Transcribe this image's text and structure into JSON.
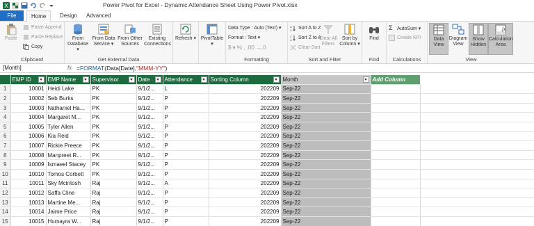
{
  "window": {
    "title": "Power Pivot for Excel - Dynamic Attendance Sheet Using Power Pivot.xlsx"
  },
  "tabs": {
    "file": "File",
    "home": "Home",
    "design": "Design",
    "advanced": "Advanced"
  },
  "ribbon": {
    "clipboard": {
      "label": "Clipboard",
      "paste": "Paste",
      "paste_append": "Paste Append",
      "paste_replace": "Paste Replace",
      "copy": "Copy"
    },
    "external": {
      "label": "Get External Data",
      "from_database": "From Database ▾",
      "from_data_service": "From Data Service ▾",
      "from_other_sources": "From Other Sources",
      "existing_connections": "Existing Connections"
    },
    "refresh": {
      "refresh": "Refresh ▾"
    },
    "pivot": {
      "pivottable": "PivotTable ▾"
    },
    "formatting": {
      "label": "Formatting",
      "data_type": "Data Type : Auto (Text) ▾",
      "format": "Format : Text ▾",
      "symbols": "$ ▾  %  ,  .00  →.0"
    },
    "sort_filter": {
      "label": "Sort and Filter",
      "sort_az": "Sort A to Z",
      "sort_za": "Sort Z to A",
      "clear_sort": "Clear Sort",
      "clear_all_filters": "Clear All Filters",
      "sort_by_column": "Sort by Column ▾"
    },
    "find": {
      "label": "Find",
      "find": "Find"
    },
    "calculations": {
      "label": "Calculations",
      "autosum": "AutoSum ▾",
      "create_kpi": "Create KPI"
    },
    "view": {
      "label": "View",
      "data_view": "Data View",
      "diagram_view": "Diagram View",
      "show_hidden": "Show Hidden",
      "calculation_area": "Calculation Area"
    }
  },
  "formula_bar": {
    "name_box": "[Month]",
    "fx": "fx",
    "formula_prefix": "=",
    "formula_fn": "FORMAT",
    "formula_args": "(Data[Date],",
    "formula_str": "\"MMM-YY\"",
    "formula_close": ")"
  },
  "table": {
    "columns": [
      "EMP ID",
      "EMP Name",
      "Supervisor",
      "Date",
      "Attendance",
      "Sorting Column",
      "Month",
      "Add Column"
    ],
    "rows": [
      [
        "1",
        "10001",
        "Heidi Lake",
        "PK",
        "9/1/2...",
        "L",
        "202209",
        "Sep-22"
      ],
      [
        "2",
        "10002",
        "Seb Burks",
        "PK",
        "9/1/2...",
        "P",
        "202209",
        "Sep-22"
      ],
      [
        "3",
        "10003",
        "Nathaniel Ha...",
        "PK",
        "9/1/2...",
        "P",
        "202209",
        "Sep-22"
      ],
      [
        "4",
        "10004",
        "Margaret M...",
        "PK",
        "9/1/2...",
        "P",
        "202209",
        "Sep-22"
      ],
      [
        "5",
        "10005",
        "Tyler Allen",
        "PK",
        "9/1/2...",
        "P",
        "202209",
        "Sep-22"
      ],
      [
        "6",
        "10006",
        "Kia Reid",
        "PK",
        "9/1/2...",
        "P",
        "202209",
        "Sep-22"
      ],
      [
        "7",
        "10007",
        "Rickie Preece",
        "PK",
        "9/1/2...",
        "P",
        "202209",
        "Sep-22"
      ],
      [
        "8",
        "10008",
        "Manpreet R...",
        "PK",
        "9/1/2...",
        "P",
        "202209",
        "Sep-22"
      ],
      [
        "9",
        "10009",
        "Ismaeel Stacey",
        "PK",
        "9/1/2...",
        "P",
        "202209",
        "Sep-22"
      ],
      [
        "10",
        "10010",
        "Tomos Corbett",
        "PK",
        "9/1/2...",
        "P",
        "202209",
        "Sep-22"
      ],
      [
        "11",
        "10011",
        "Sky Mcintosh",
        "Raj",
        "9/1/2...",
        "A",
        "202209",
        "Sep-22"
      ],
      [
        "12",
        "10012",
        "Saffa Cline",
        "Raj",
        "9/1/2...",
        "P",
        "202209",
        "Sep-22"
      ],
      [
        "13",
        "10013",
        "Martine Me...",
        "Raj",
        "9/1/2...",
        "P",
        "202209",
        "Sep-22"
      ],
      [
        "14",
        "10014",
        "Jaime Price",
        "Raj",
        "9/1/2...",
        "P",
        "202209",
        "Sep-22"
      ],
      [
        "15",
        "10015",
        "Humayra W...",
        "Raj",
        "9/1/2...",
        "P",
        "202209",
        "Sep-22"
      ]
    ]
  },
  "colors": {
    "header_green": "#1e6b40",
    "add_column_green": "#5f9e6e",
    "selected_col_gray": "#bdbdbd",
    "file_tab_blue": "#1e6fc5"
  }
}
